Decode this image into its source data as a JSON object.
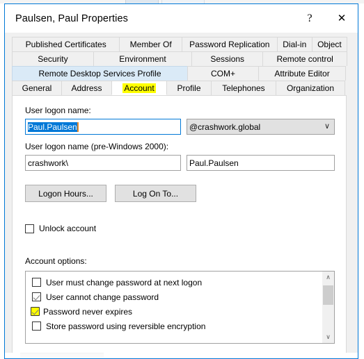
{
  "window": {
    "title": "Paulsen, Paul Properties",
    "help_glyph": "?",
    "close_glyph": "✕"
  },
  "tabs": {
    "row1": [
      {
        "label": "Published Certificates",
        "state": "normal"
      },
      {
        "label": "Member Of",
        "state": "normal"
      },
      {
        "label": "Password Replication",
        "state": "normal"
      },
      {
        "label": "Dial-in",
        "state": "normal"
      },
      {
        "label": "Object",
        "state": "normal"
      }
    ],
    "row2": [
      {
        "label": "Security",
        "state": "normal"
      },
      {
        "label": "Environment",
        "state": "normal"
      },
      {
        "label": "Sessions",
        "state": "normal"
      },
      {
        "label": "Remote control",
        "state": "normal"
      }
    ],
    "row3": [
      {
        "label": "Remote Desktop Services Profile",
        "state": "hovered"
      },
      {
        "label": "COM+",
        "state": "normal"
      },
      {
        "label": "Attribute Editor",
        "state": "normal"
      }
    ],
    "row4": [
      {
        "label": "General",
        "state": "normal"
      },
      {
        "label": "Address",
        "state": "normal"
      },
      {
        "label": "Account",
        "state": "active"
      },
      {
        "label": "Profile",
        "state": "normal"
      },
      {
        "label": "Telephones",
        "state": "normal"
      },
      {
        "label": "Organization",
        "state": "normal"
      }
    ]
  },
  "account": {
    "logon_name_label": "User logon name:",
    "logon_name_value": "Paul.Paulsen",
    "upn_suffix_value": "@crashwork.global",
    "pre2000_label": "User logon name (pre-Windows 2000):",
    "pre2000_domain": "crashwork\\",
    "pre2000_name": "Paul.Paulsen",
    "logon_hours_button": "Logon Hours...",
    "log_on_to_button": "Log On To...",
    "unlock_account_label": "Unlock account",
    "unlock_account_checked": false,
    "options_label": "Account options:",
    "options": [
      {
        "label": "User must change password at next logon",
        "checked": false,
        "highlighted": false
      },
      {
        "label": "User cannot change password",
        "checked": true,
        "highlighted": false
      },
      {
        "label": "Password never expires",
        "checked": true,
        "highlighted": true
      },
      {
        "label": "Store password using reversible encryption",
        "checked": false,
        "highlighted": false
      }
    ],
    "scroll_up_glyph": "∧",
    "scroll_down_glyph": "∨",
    "dropdown_glyph": "∨"
  },
  "colors": {
    "accent": "#0078d7",
    "highlight": "#ffff00",
    "selection": "#0078d7",
    "caret": "#e88a2a",
    "tab_hover": "#daeaf7"
  }
}
